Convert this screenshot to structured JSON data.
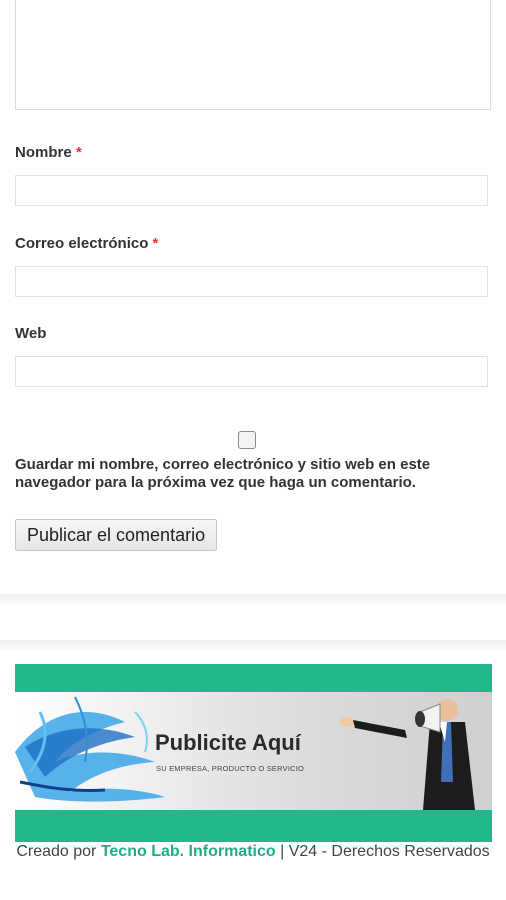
{
  "form": {
    "name_label": "Nombre",
    "email_label": "Correo electrónico",
    "web_label": "Web",
    "required_mark": "*",
    "consent_text": "Guardar mi nombre, correo electrónico y sitio web en este navegador para la próxima vez que haga un comentario.",
    "consent_checked": false,
    "submit_label": "Publicar el comentario"
  },
  "banner": {
    "title": "Publicite Aquí",
    "subtitle": "SU EMPRESA, PRODUCTO O SERVICIO",
    "accent_color": "#20b98c"
  },
  "footer": {
    "prefix": "Creado por",
    "link_text": "Tecno Lab. Informatico",
    "suffix": "| V24 - Derechos Reservados",
    "link_color": "#1fae84"
  }
}
